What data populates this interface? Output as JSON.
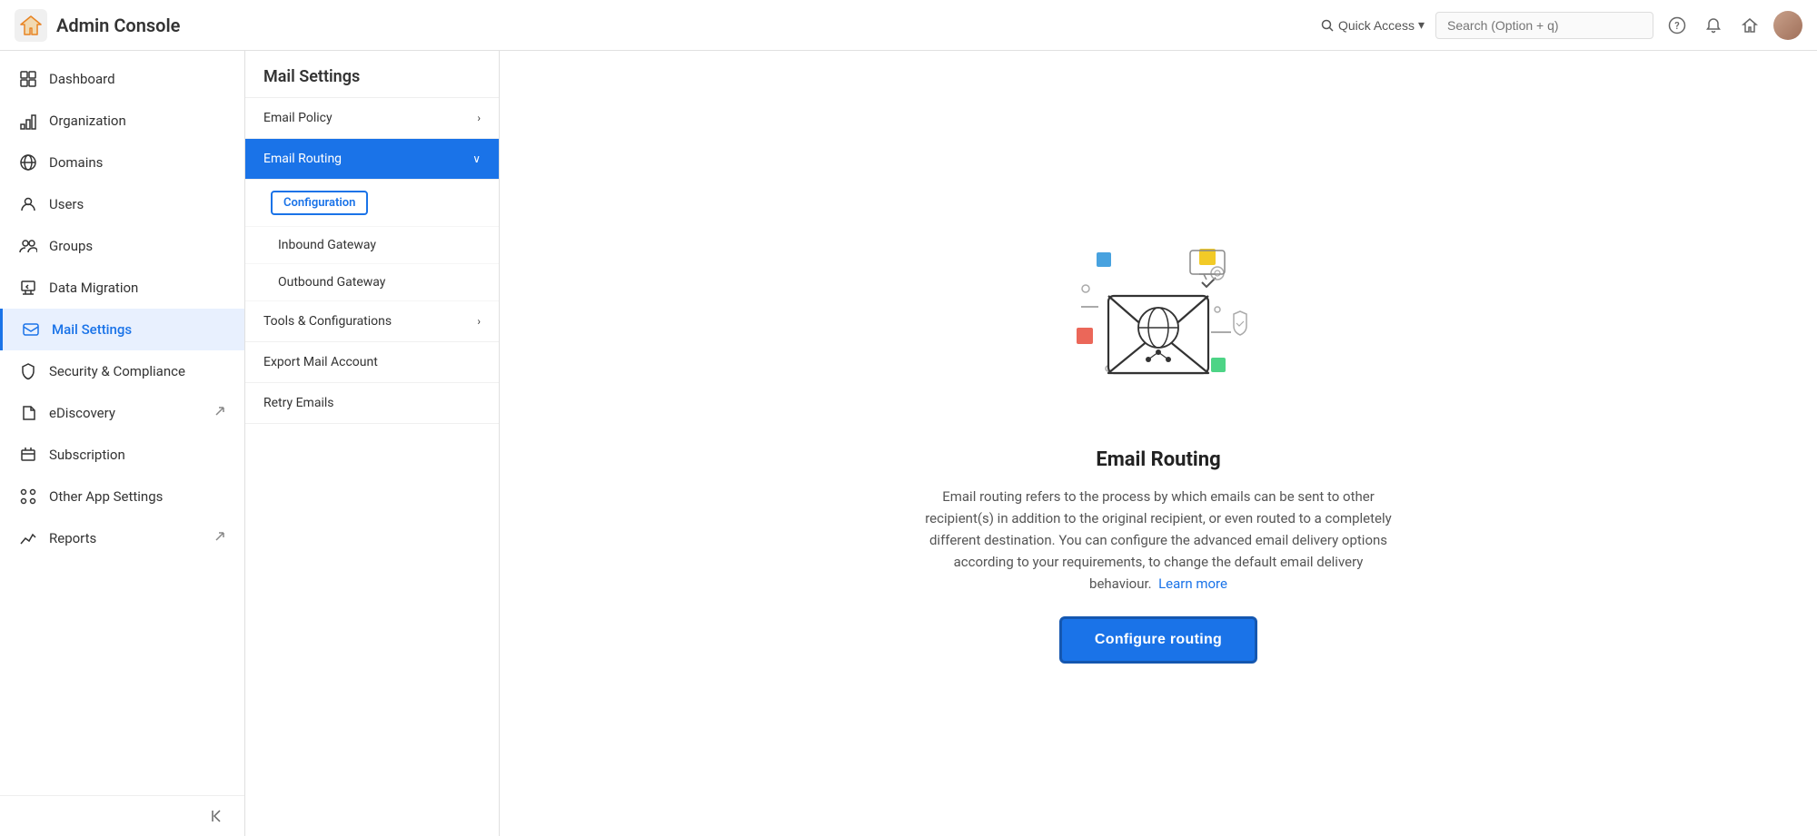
{
  "header": {
    "logo_text": "Admin Console",
    "quick_access_label": "Quick Access",
    "search_placeholder": "Search (Option + q)",
    "page_title": "Mail Settings"
  },
  "sidebar": {
    "items": [
      {
        "id": "dashboard",
        "label": "Dashboard",
        "icon": "grid"
      },
      {
        "id": "organization",
        "label": "Organization",
        "icon": "bar-chart"
      },
      {
        "id": "domains",
        "label": "Domains",
        "icon": "globe"
      },
      {
        "id": "users",
        "label": "Users",
        "icon": "person"
      },
      {
        "id": "groups",
        "label": "Groups",
        "icon": "people"
      },
      {
        "id": "data-migration",
        "label": "Data Migration",
        "icon": "download"
      },
      {
        "id": "mail-settings",
        "label": "Mail Settings",
        "icon": "mail",
        "active": true
      },
      {
        "id": "security",
        "label": "Security & Compliance",
        "icon": "shield"
      },
      {
        "id": "ediscovery",
        "label": "eDiscovery",
        "icon": "folder",
        "ext": true
      },
      {
        "id": "subscription",
        "label": "Subscription",
        "icon": "receipt"
      },
      {
        "id": "other-app",
        "label": "Other App Settings",
        "icon": "grid-2"
      },
      {
        "id": "reports",
        "label": "Reports",
        "icon": "trend",
        "ext": true
      }
    ],
    "collapse_label": "Collapse"
  },
  "submenu": {
    "items": [
      {
        "id": "email-policy",
        "label": "Email Policy",
        "has_arrow": true
      },
      {
        "id": "email-routing",
        "label": "Email Routing",
        "expanded": true,
        "sub_items": [
          {
            "id": "configuration",
            "label": "Configuration",
            "active": true
          },
          {
            "id": "inbound-gateway",
            "label": "Inbound Gateway"
          },
          {
            "id": "outbound-gateway",
            "label": "Outbound Gateway"
          }
        ]
      },
      {
        "id": "tools-config",
        "label": "Tools & Configurations",
        "has_arrow": true
      },
      {
        "id": "export-mail",
        "label": "Export Mail Account"
      },
      {
        "id": "retry-emails",
        "label": "Retry Emails"
      }
    ]
  },
  "main_content": {
    "title": "Email Routing",
    "description": "Email routing refers to the process by which emails can be sent to other recipient(s) in addition to the original recipient, or even routed to a completely different destination. You can configure the advanced email delivery options according to your requirements, to change the default email delivery behaviour.",
    "learn_more_label": "Learn more",
    "configure_btn_label": "Configure routing"
  },
  "colors": {
    "primary": "#1a73e8",
    "primary_dark": "#1557b0",
    "active_bg": "#e8f0fe",
    "sidebar_border": "#e0e0e0"
  }
}
